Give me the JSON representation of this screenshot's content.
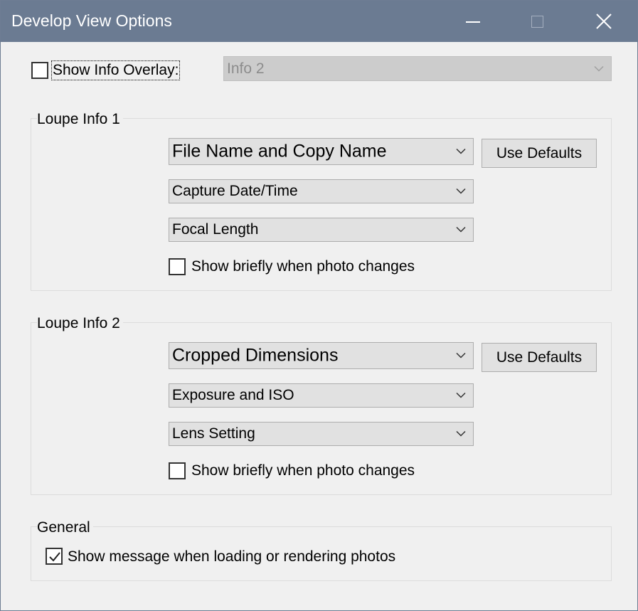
{
  "window": {
    "title": "Develop View Options"
  },
  "overlay": {
    "show_label": "Show Info Overlay:",
    "checked": false,
    "selected": "Info 2",
    "enabled": false
  },
  "loupe1": {
    "title": "Loupe Info 1",
    "field1": "File Name and Copy Name",
    "field2": "Capture Date/Time",
    "field3": "Focal Length",
    "use_defaults_label": "Use Defaults",
    "show_briefly_label": "Show briefly when photo changes",
    "show_briefly_checked": false
  },
  "loupe2": {
    "title": "Loupe Info 2",
    "field1": "Cropped Dimensions",
    "field2": "Exposure and ISO",
    "field3": "Lens Setting",
    "use_defaults_label": "Use Defaults",
    "show_briefly_label": "Show briefly when photo changes",
    "show_briefly_checked": false
  },
  "general": {
    "title": "General",
    "show_message_label": "Show message when loading or rendering photos",
    "show_message_checked": true
  },
  "colors": {
    "titlebar": "#6b7b92",
    "dialog_bg": "#f0f0f0",
    "control_bg": "#e1e1e1"
  }
}
